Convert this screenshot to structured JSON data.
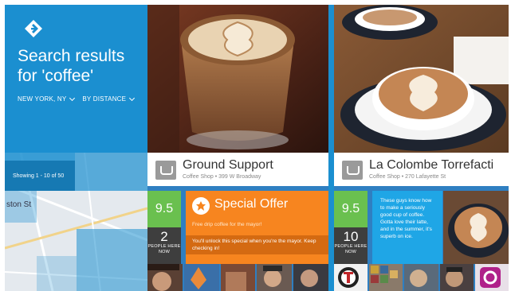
{
  "search": {
    "title_line1": "Search results",
    "title_line2": "for 'coffee'",
    "filter_location": "NEW YORK, NY",
    "filter_sort": "BY DISTANCE",
    "showing": "Showing 1 - 10 of 50",
    "map_street_label": "ston St"
  },
  "venues": [
    {
      "name": "Ground Support",
      "subtitle": "Coffee Shop • 399 W Broadway",
      "score": "9.5",
      "people_here": "2",
      "people_here_label_1": "PEOPLE HERE",
      "people_here_label_2": "NOW",
      "offer_title": "Special Offer",
      "offer_text": "Free drip coffee for the mayor!",
      "offer_ribbon": "You'll unlock this special when you're the mayor. Keep checking in!"
    },
    {
      "name": "La Colombe Torrefacti",
      "subtitle": "Coffee Shop • 270 Lafayette St",
      "score": "9.5",
      "people_here": "10",
      "people_here_label_1": "PEOPLE HERE",
      "people_here_label_2": "NOW",
      "tip": "These guys know how to make a seriously good cup of coffee. Gotta love their latte, and in the summer, it's superb on ice."
    }
  ],
  "colors": {
    "brand_blue": "#1b8fd0",
    "score_green": "#6ac04f",
    "offer_orange": "#f7851f",
    "tip_blue": "#1fa6e6"
  },
  "icons": {
    "logo": "foursquare-logo-icon",
    "venue": "coffee-cup-icon",
    "offer": "special-offer-badge-icon"
  }
}
